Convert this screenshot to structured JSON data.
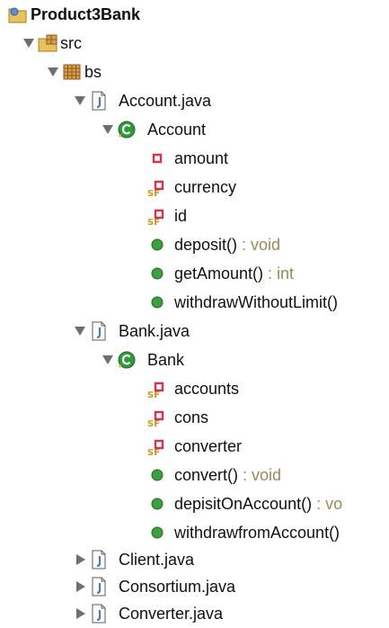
{
  "tree": {
    "project": "Product3Bank",
    "src": "src",
    "package": "bs",
    "account_file": "Account.java",
    "account_class": "Account",
    "account_members": [
      {
        "name": "amount",
        "suffix": ""
      },
      {
        "name": "currency",
        "suffix": ""
      },
      {
        "name": "id",
        "suffix": ""
      },
      {
        "name": "deposit()",
        "suffix": " : void"
      },
      {
        "name": "getAmount()",
        "suffix": " : int"
      },
      {
        "name": "withdrawWithoutLimit()",
        "suffix": ""
      }
    ],
    "bank_file": "Bank.java",
    "bank_class": "Bank",
    "bank_members": [
      {
        "name": "accounts",
        "suffix": ""
      },
      {
        "name": "cons",
        "suffix": ""
      },
      {
        "name": "converter",
        "suffix": ""
      },
      {
        "name": "convert()",
        "suffix": " : void"
      },
      {
        "name": "depisitOnAccount()",
        "suffix": " : vo"
      },
      {
        "name": "withdrawfromAccount()",
        "suffix": ""
      }
    ],
    "other_files": [
      "Client.java",
      "Consortium.java",
      "Converter.java"
    ]
  },
  "colors": {
    "public_method": "#3aa041",
    "private_field": "#d8334a",
    "class_icon": "#2f9a3a",
    "package_icon": "#b97d3a",
    "java_file_icon": "#5577bb",
    "return_type": "#9a8a5a"
  }
}
